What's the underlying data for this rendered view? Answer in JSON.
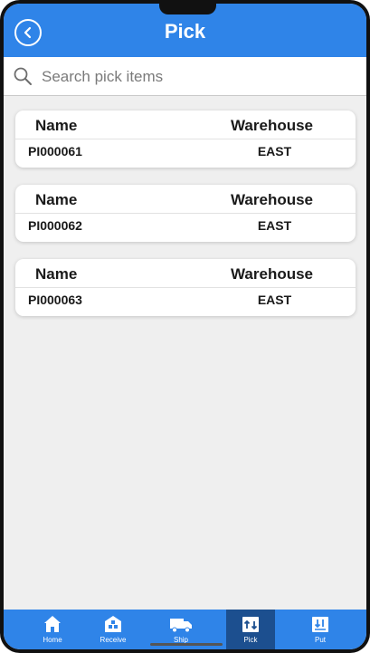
{
  "header": {
    "title": "Pick"
  },
  "search": {
    "placeholder": "Search pick items"
  },
  "items": [
    {
      "name_header": "Name",
      "warehouse_header": "Warehouse",
      "name": "PI000061",
      "warehouse": "EAST"
    },
    {
      "name_header": "Name",
      "warehouse_header": "Warehouse",
      "name": "PI000062",
      "warehouse": "EAST"
    },
    {
      "name_header": "Name",
      "warehouse_header": "Warehouse",
      "name": "PI000063",
      "warehouse": "EAST"
    }
  ],
  "tabs": [
    {
      "label": "Home",
      "icon": "home-icon"
    },
    {
      "label": "Receive",
      "icon": "receive-icon"
    },
    {
      "label": "Ship",
      "icon": "truck-icon"
    },
    {
      "label": "Pick",
      "icon": "pick-icon",
      "active": true
    },
    {
      "label": "Put",
      "icon": "put-icon"
    }
  ],
  "colors": {
    "primary": "#2f84e8",
    "active_tab": "#1c4f8f",
    "background": "#efefef"
  }
}
